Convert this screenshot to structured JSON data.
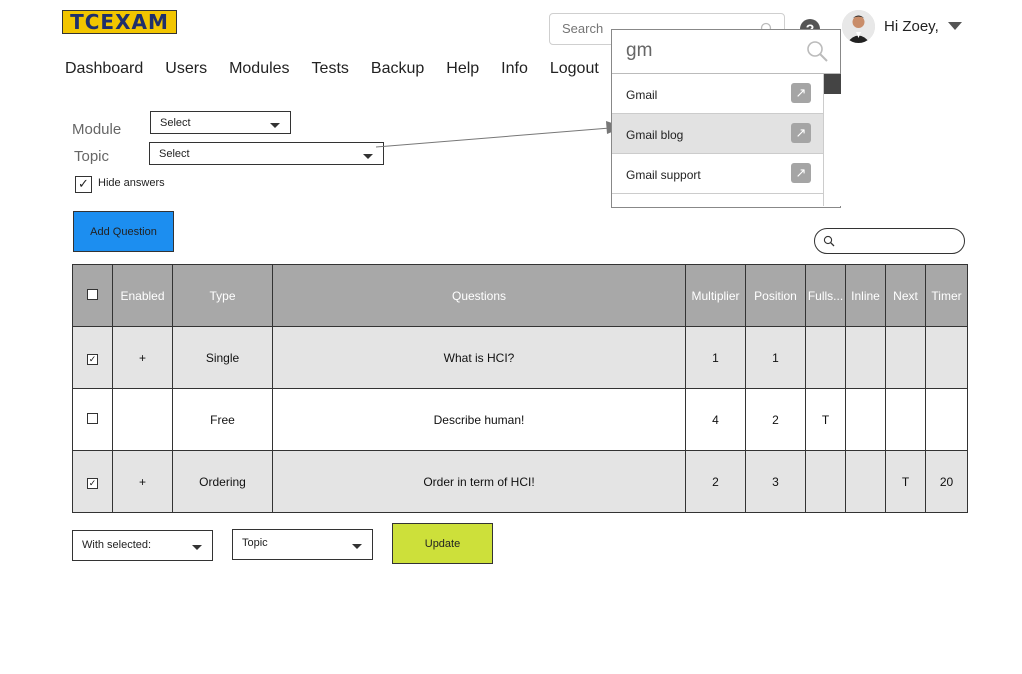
{
  "logo": {
    "text": "TCEXAM"
  },
  "top_search": {
    "placeholder": "Search"
  },
  "user": {
    "greeting": "Hi Zoey,"
  },
  "nav": [
    "Dashboard",
    "Users",
    "Modules",
    "Tests",
    "Backup",
    "Help",
    "Info",
    "Logout"
  ],
  "dropdown": {
    "query": "gm",
    "items": [
      "Gmail",
      "Gmail blog",
      "Gmail support"
    ],
    "highlighted_index": 1
  },
  "form": {
    "module_label": "Module",
    "module_value": "Select",
    "topic_label": "Topic",
    "topic_value": "Select",
    "hide_answers_label": "Hide answers",
    "hide_answers_checked": true,
    "add_question_label": "Add Question"
  },
  "table": {
    "headers": [
      "",
      "Enabled",
      "Type",
      "Questions",
      "Multiplier",
      "Position",
      "Fulls...",
      "Inline",
      "Next",
      "Timer"
    ],
    "rows": [
      {
        "checked": true,
        "enabled": "+",
        "type": "Single",
        "question": "What is HCI?",
        "multiplier": "1",
        "position": "1",
        "fullscreen": "",
        "inline": "",
        "next": "",
        "timer": ""
      },
      {
        "checked": false,
        "enabled": "",
        "type": "Free",
        "question": "Describe human!",
        "multiplier": "4",
        "position": "2",
        "fullscreen": "T",
        "inline": "",
        "next": "",
        "timer": ""
      },
      {
        "checked": true,
        "enabled": "+",
        "type": "Ordering",
        "question": "Order in term of HCI!",
        "multiplier": "2",
        "position": "3",
        "fullscreen": "",
        "inline": "",
        "next": "T",
        "timer": "20"
      }
    ]
  },
  "bottom": {
    "with_selected": "With selected:",
    "topic": "Topic",
    "update_label": "Update"
  },
  "colors": {
    "logo_bg": "#f2c500",
    "add_button": "#1c8ef0",
    "update_button": "#cde03a",
    "table_header": "#a8a8a8"
  }
}
